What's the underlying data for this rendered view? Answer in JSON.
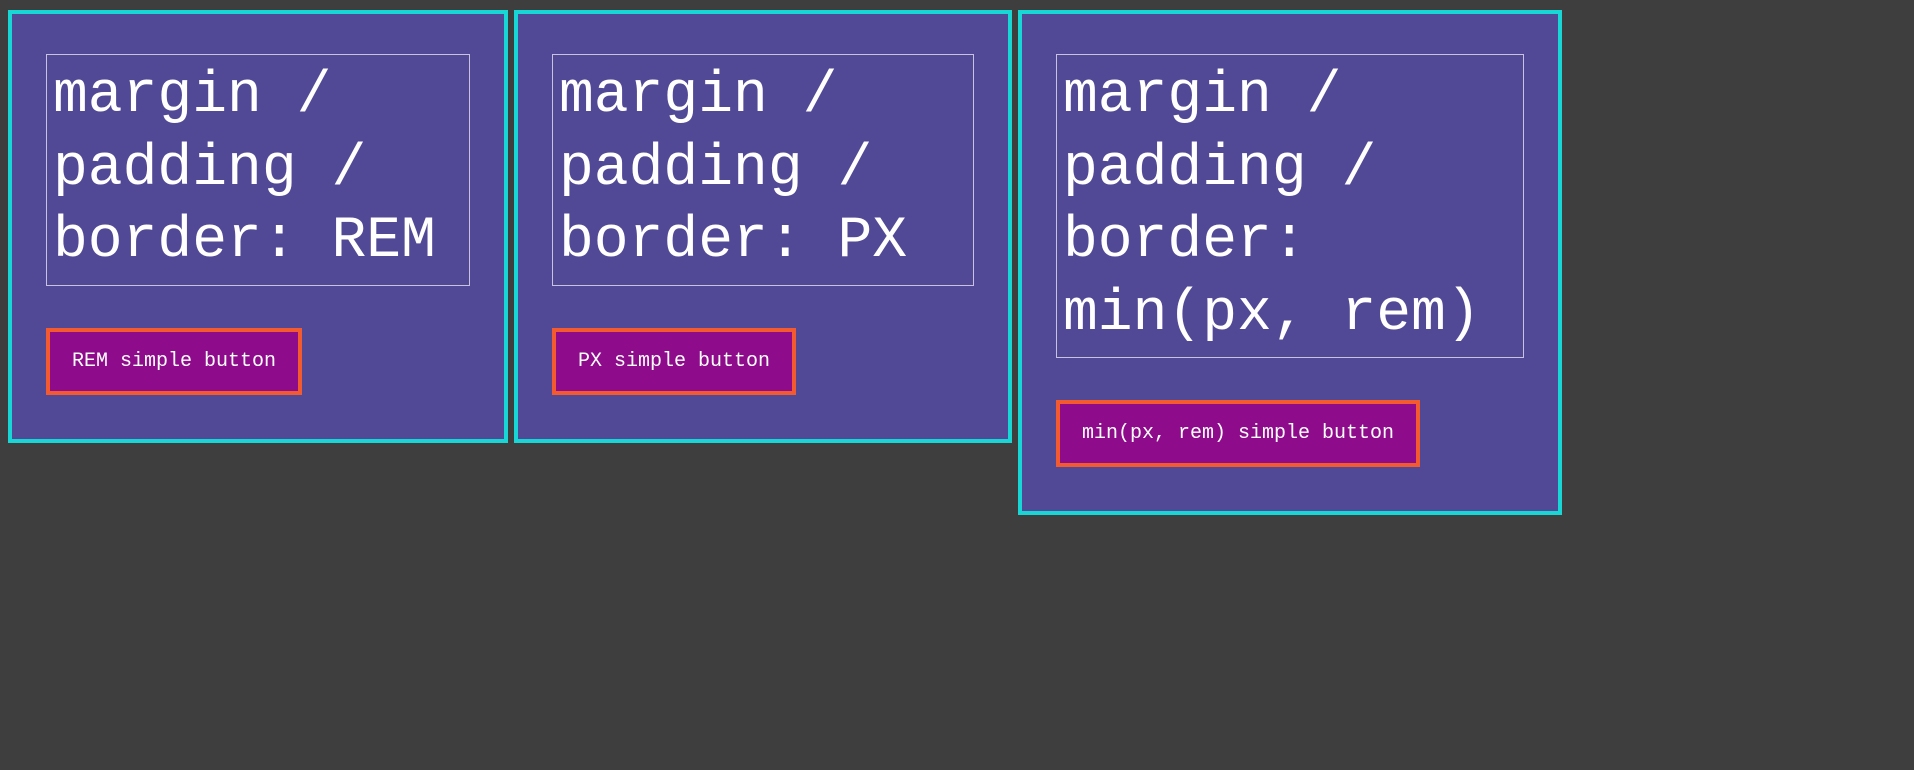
{
  "panels": [
    {
      "heading": "margin / padding / border: REM",
      "button_label": "REM simple button"
    },
    {
      "heading": "margin / padding / border: PX",
      "button_label": "PX simple button"
    },
    {
      "heading": "margin / padding / border: min(px, rem)",
      "button_label": "min(px, rem) simple button"
    }
  ]
}
